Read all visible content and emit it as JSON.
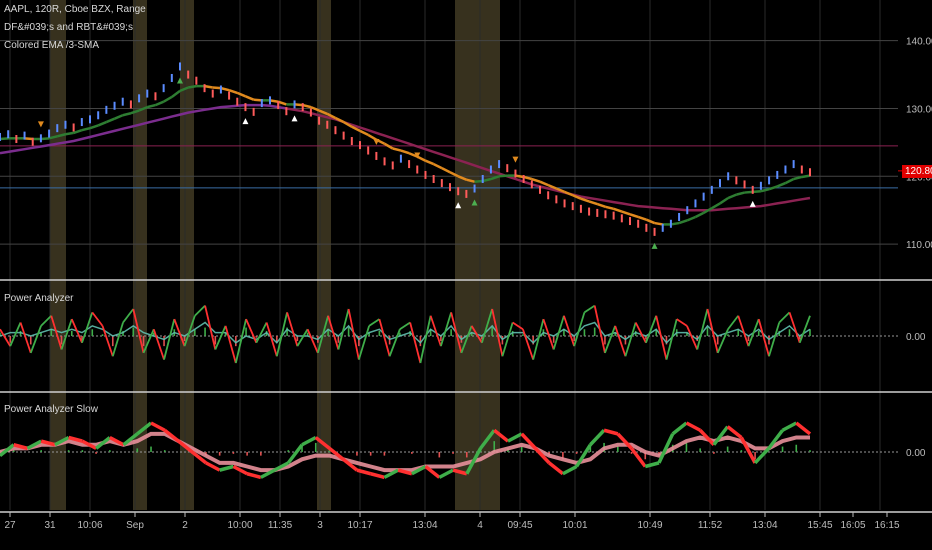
{
  "legend": {
    "line1": "AAPL, 120R, Cboe BZX, Range",
    "line2": "DF&#039;s and RBT&#039;s",
    "line3": "Colored EMA /3-SMA"
  },
  "panels": {
    "osc1_title": "Power Analyzer",
    "osc2_title": "Power Analyzer Slow"
  },
  "last_price": "120.80",
  "colors": {
    "accent_red": "#e00000",
    "ema_green": "#2e7d32",
    "ema_orange": "#e08a1e",
    "sma_purple": "#7b2d8e",
    "sma_maroon": "#8b2252",
    "session_band": "#4a4128",
    "candle_blue": "#5b8cff",
    "candle_red": "#ff5b5b"
  },
  "chart_data": [
    {
      "type": "line",
      "panel": "price",
      "y_ticks": [
        "140.00",
        "130.00",
        "120.00",
        "110.00"
      ],
      "y_tick_values": [
        140,
        130,
        120,
        110
      ],
      "ylim": [
        105,
        146
      ],
      "x_ticks": [
        "27",
        "31",
        "10:06",
        "Sep",
        "2",
        "10:00",
        "11:35",
        "3",
        "10:17",
        "13:04",
        "4",
        "09:45",
        "10:01",
        "10:49",
        "11:52",
        "13:04",
        "15:45",
        "16:05",
        "16:15"
      ],
      "price_line_value": 120.8,
      "series": [
        {
          "key": "price",
          "values": [
            125.8,
            126.2,
            125.5,
            126.0,
            125.1,
            125.6,
            126.3,
            127.1,
            127.6,
            127.2,
            128.0,
            128.4,
            129.0,
            129.8,
            130.4,
            131.0,
            130.6,
            131.5,
            132.2,
            131.8,
            133.0,
            134.5,
            136.2,
            135.0,
            134.1,
            133.0,
            132.2,
            132.8,
            131.9,
            131.0,
            130.2,
            129.5,
            130.8,
            131.2,
            130.5,
            129.6,
            130.6,
            130.2,
            129.4,
            128.2,
            127.6,
            126.8,
            126.0,
            125.2,
            124.6,
            123.8,
            123.0,
            122.2,
            121.6,
            122.6,
            121.8,
            121.0,
            120.2,
            119.6,
            119.0,
            118.4,
            117.8,
            117.4,
            118.2,
            119.6,
            121.0,
            121.8,
            121.2,
            120.4,
            119.6,
            118.8,
            118.0,
            117.2,
            116.6,
            116.0,
            115.6,
            115.2,
            114.8,
            114.6,
            114.4,
            114.2,
            113.8,
            113.4,
            113.0,
            112.4,
            111.8,
            112.4,
            113.0,
            114.0,
            115.0,
            116.0,
            117.0,
            118.0,
            119.0,
            120.0,
            119.4,
            118.8,
            118.0,
            118.6,
            119.4,
            120.2,
            121.0,
            121.8,
            121.0,
            120.6
          ]
        },
        {
          "key": "ema_fast",
          "values": [
            125.5,
            125.6,
            125.6,
            125.6,
            125.5,
            125.5,
            125.6,
            125.9,
            126.2,
            126.4,
            126.8,
            127.1,
            127.5,
            128.0,
            128.5,
            129.0,
            129.3,
            129.7,
            130.2,
            130.5,
            131.0,
            131.7,
            132.6,
            133.1,
            133.3,
            133.3,
            133.1,
            133.0,
            132.7,
            132.3,
            131.8,
            131.3,
            131.2,
            131.2,
            131.0,
            130.6,
            130.6,
            130.5,
            130.2,
            129.7,
            129.2,
            128.6,
            128.0,
            127.3,
            126.7,
            126.1,
            125.4,
            124.8,
            124.1,
            123.8,
            123.4,
            122.9,
            122.3,
            121.8,
            121.2,
            120.6,
            120.0,
            119.5,
            119.2,
            119.3,
            119.6,
            120.0,
            120.1,
            120.1,
            119.9,
            119.6,
            119.2,
            118.7,
            118.2,
            117.7,
            117.2,
            116.7,
            116.3,
            115.9,
            115.5,
            115.2,
            114.8,
            114.4,
            114.0,
            113.6,
            113.1,
            112.9,
            112.9,
            113.1,
            113.5,
            114.0,
            114.6,
            115.3,
            116.0,
            116.8,
            117.3,
            117.6,
            117.7,
            117.8,
            118.1,
            118.5,
            119.0,
            119.6,
            119.9,
            120.1
          ]
        },
        {
          "key": "sma_slow",
          "values": [
            123.4,
            123.6,
            123.8,
            124.0,
            124.2,
            124.4,
            124.6,
            124.8,
            125.0,
            125.2,
            125.5,
            125.8,
            126.1,
            126.4,
            126.7,
            127.0,
            127.3,
            127.6,
            127.9,
            128.2,
            128.5,
            128.8,
            129.1,
            129.4,
            129.6,
            129.8,
            130.0,
            130.2,
            130.3,
            130.4,
            130.5,
            130.5,
            130.5,
            130.4,
            130.2,
            130.0,
            129.8,
            129.6,
            129.3,
            129.0,
            128.7,
            128.4,
            128.0,
            127.6,
            127.2,
            126.8,
            126.4,
            126.0,
            125.6,
            125.2,
            124.8,
            124.4,
            124.0,
            123.6,
            123.2,
            122.8,
            122.4,
            122.0,
            121.6,
            121.2,
            120.8,
            120.4,
            120.0,
            119.6,
            119.2,
            118.8,
            118.5,
            118.2,
            117.9,
            117.6,
            117.3,
            117.0,
            116.8,
            116.6,
            116.4,
            116.2,
            116.0,
            115.8,
            115.6,
            115.5,
            115.4,
            115.3,
            115.2,
            115.1,
            115.0,
            115.0,
            115.0,
            115.0,
            115.1,
            115.2,
            115.3,
            115.4,
            115.5,
            115.6,
            115.8,
            116.0,
            116.2,
            116.4,
            116.6,
            116.8
          ]
        }
      ]
    },
    {
      "type": "line",
      "panel": "osc1",
      "y_ticks": [
        "0.00"
      ],
      "y_tick_values": [
        0
      ],
      "ylim": [
        -1.2,
        1.2
      ],
      "series": [
        {
          "key": "fast",
          "values": [
            0.2,
            -0.3,
            0.4,
            -0.5,
            0.3,
            0.6,
            -0.4,
            0.5,
            -0.2,
            0.7,
            0.3,
            -0.6,
            0.4,
            0.8,
            -0.5,
            0.2,
            -0.7,
            0.5,
            -0.3,
            0.6,
            0.9,
            -0.4,
            0.3,
            -0.8,
            0.5,
            -0.2,
            0.4,
            -0.6,
            0.7,
            -0.3,
            0.2,
            -0.5,
            0.6,
            -0.4,
            0.8,
            -0.7,
            0.3,
            0.5,
            -0.6,
            0.2,
            0.4,
            -0.8,
            0.6,
            -0.3,
            0.7,
            -0.5,
            0.3,
            -0.2,
            0.8,
            -0.6,
            0.4,
            0.2,
            -0.7,
            0.5,
            -0.4,
            0.6,
            -0.3,
            0.7,
            0.9,
            -0.5,
            0.3,
            -0.6,
            0.4,
            -0.2,
            0.6,
            -0.7,
            0.5,
            0.3,
            -0.4,
            0.8,
            -0.5,
            0.2,
            0.6,
            -0.3,
            0.5,
            -0.6,
            0.4,
            0.7,
            -0.2,
            0.6
          ]
        },
        {
          "key": "slow",
          "values": [
            0.0,
            0.1,
            0.1,
            0.0,
            0.1,
            0.2,
            0.1,
            0.2,
            0.1,
            0.3,
            0.2,
            0.0,
            0.1,
            0.3,
            0.1,
            0.0,
            -0.1,
            0.1,
            0.0,
            0.2,
            0.4,
            0.1,
            0.1,
            -0.2,
            0.0,
            -0.1,
            0.1,
            -0.2,
            0.2,
            0.0,
            0.0,
            -0.1,
            0.2,
            0.0,
            0.3,
            -0.1,
            0.1,
            0.2,
            -0.1,
            0.0,
            0.1,
            -0.2,
            0.2,
            0.0,
            0.3,
            -0.1,
            0.1,
            0.0,
            0.3,
            -0.1,
            0.1,
            0.1,
            -0.2,
            0.1,
            0.0,
            0.2,
            0.0,
            0.3,
            0.4,
            0.0,
            0.1,
            -0.1,
            0.1,
            0.0,
            0.2,
            -0.2,
            0.1,
            0.1,
            -0.1,
            0.3,
            0.0,
            0.1,
            0.2,
            0.0,
            0.2,
            -0.1,
            0.1,
            0.3,
            0.0,
            0.2
          ]
        }
      ]
    },
    {
      "type": "line",
      "panel": "osc2",
      "y_ticks": [
        "0.00"
      ],
      "y_tick_values": [
        0
      ],
      "ylim": [
        -1.2,
        1.2
      ],
      "series": [
        {
          "key": "fast",
          "values": [
            -0.1,
            0.2,
            0.1,
            0.3,
            0.2,
            0.4,
            0.3,
            0.1,
            0.4,
            0.2,
            0.5,
            0.8,
            0.6,
            0.3,
            0.0,
            -0.3,
            -0.5,
            -0.4,
            -0.6,
            -0.7,
            -0.5,
            -0.3,
            0.2,
            0.4,
            0.1,
            -0.2,
            -0.5,
            -0.6,
            -0.7,
            -0.5,
            -0.6,
            -0.4,
            -0.7,
            -0.5,
            -0.6,
            0.1,
            0.6,
            0.3,
            0.5,
            0.1,
            -0.3,
            -0.6,
            -0.4,
            0.2,
            0.6,
            0.5,
            0.1,
            -0.4,
            -0.3,
            0.5,
            0.8,
            0.6,
            0.2,
            0.7,
            0.4,
            -0.3,
            0.1,
            0.6,
            0.8,
            0.5
          ]
        },
        {
          "key": "slow",
          "values": [
            0.0,
            0.1,
            0.1,
            0.2,
            0.2,
            0.3,
            0.2,
            0.2,
            0.3,
            0.2,
            0.3,
            0.5,
            0.5,
            0.3,
            0.1,
            -0.1,
            -0.3,
            -0.3,
            -0.4,
            -0.5,
            -0.5,
            -0.4,
            -0.2,
            -0.1,
            -0.1,
            -0.2,
            -0.3,
            -0.4,
            -0.5,
            -0.5,
            -0.5,
            -0.4,
            -0.4,
            -0.4,
            -0.3,
            -0.2,
            0.0,
            0.1,
            0.2,
            0.1,
            -0.1,
            -0.2,
            -0.3,
            -0.2,
            0.1,
            0.2,
            0.2,
            0.0,
            -0.1,
            0.1,
            0.3,
            0.4,
            0.3,
            0.4,
            0.3,
            0.1,
            0.1,
            0.3,
            0.4,
            0.4
          ]
        }
      ]
    }
  ]
}
